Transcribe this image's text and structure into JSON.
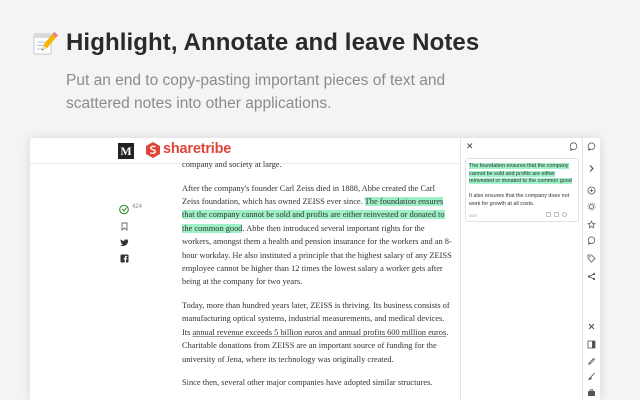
{
  "hero": {
    "title": "Highlight, Annotate and leave Notes",
    "subtitle": "Put an end to copy-pasting important pieces of text and scattered notes into other applications.",
    "icon": "notepad-pencil-icon"
  },
  "site": {
    "medium_logo": "M",
    "brand": "sharetribe"
  },
  "sidebar": {
    "clap_count": "424"
  },
  "article": {
    "p0": "company and society at large.",
    "p1_a": "After the company's founder Carl Zeiss died in 1888, Abbe created the Carl Zeiss foundation, which has owned ZEISS ever since. ",
    "p1_hl": "The foundation ensures that the company cannot be sold and profits are either reinvested or donated to the common good",
    "p1_b": ". Abbe then introduced several important rights for the workers, amongst them a health and pension insurance for the workers and an 8-hour workday. He also instituted a principle that the highest salary of any ZEISS employee cannot be higher than 12 times the lowest salary a worker gets after being at the company for two years.",
    "p2_a": "Today, more than hundred years later, ZEISS is thriving. Its business consists of manufacturing optical systems, industrial measurements, and medical devices. Its ",
    "p2_ul": "annual revenue exceeds 5 billion euros and annual profits 600 million euros",
    "p2_b": ". Charitable donations from ZEISS are an important source of funding for the university of Jena, where its technology was originally created.",
    "p3": "Since then, several other major companies have adopted similar structures."
  },
  "panel": {
    "card": {
      "quote": "The foundation ensures that the company cannot be sold and profits are either reinvested or donated to the common good",
      "note": "It also ensures that the company does not work for growth at all costs.",
      "date": "now"
    }
  },
  "colors": {
    "highlight": "#9ef0c6",
    "brand_red": "#e0453a"
  }
}
